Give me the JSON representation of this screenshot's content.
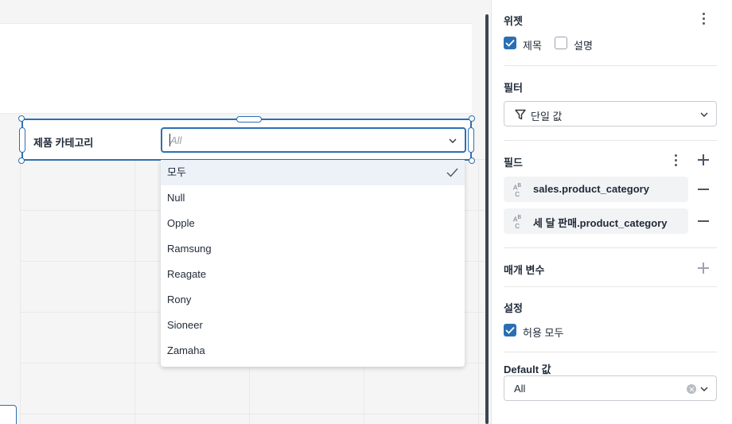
{
  "canvas": {
    "filter_widget": {
      "label": "제품 카테고리",
      "placeholder": "All"
    },
    "dropdown": {
      "options": [
        "모두",
        "Null",
        "Opple",
        "Ramsung",
        "Reagate",
        "Rony",
        "Sioneer",
        "Zamaha"
      ],
      "selected": "모두"
    }
  },
  "panel": {
    "widget": {
      "title": "위젯",
      "title_checkbox_label": "제목",
      "title_checked": true,
      "description_checkbox_label": "설명",
      "description_checked": false
    },
    "filter": {
      "title": "필터",
      "type_value": "단일 값"
    },
    "fields": {
      "title": "필드",
      "items": [
        {
          "type_icon": "abc-icon",
          "name": "sales.product_category"
        },
        {
          "type_icon": "abc-icon",
          "name": "세 달 판매.product_category"
        }
      ]
    },
    "parameters": {
      "title": "매개 변수"
    },
    "settings": {
      "title": "설정",
      "allow_all_label": "허용 모두",
      "allow_all_checked": true
    },
    "default_value": {
      "title": "Default 값",
      "value": "All"
    }
  },
  "colors": {
    "accent": "#2f6fb0",
    "checkbox": "#2a6fb3",
    "selected_row": "#edf2f8"
  }
}
